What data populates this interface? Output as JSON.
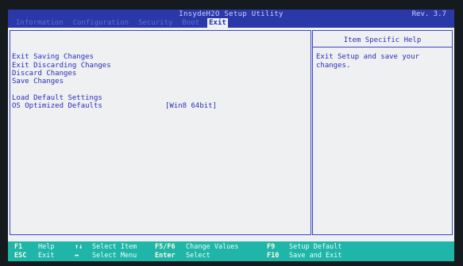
{
  "header": {
    "title": "InsydeH2O Setup Utility",
    "revision": "Rev. 3.7"
  },
  "tabs": [
    {
      "label": "Information"
    },
    {
      "label": "Configuration"
    },
    {
      "label": "Security"
    },
    {
      "label": "Boot"
    },
    {
      "label": "Exit",
      "active": true
    }
  ],
  "menu": {
    "items": [
      {
        "label": "Exit Saving Changes"
      },
      {
        "label": "Exit Discarding Changes"
      },
      {
        "label": "Discard Changes"
      },
      {
        "label": "Save Changes"
      },
      {
        "label": "Load Default Settings"
      },
      {
        "label": "OS Optimized Defaults",
        "value": "[Win8 64bit]"
      }
    ]
  },
  "help": {
    "title": "Item Specific Help",
    "text": "Exit Setup and save your changes."
  },
  "footer": {
    "row1": [
      {
        "key": "F1",
        "desc": "Help"
      },
      {
        "key": "↑↓",
        "desc": "Select Item"
      },
      {
        "key": "F5/F6",
        "desc": "Change Values"
      },
      {
        "key": "F9",
        "desc": "Setup Default"
      }
    ],
    "row2": [
      {
        "key": "ESC",
        "desc": "Exit"
      },
      {
        "key": "↔",
        "desc": "Select Menu"
      },
      {
        "key": "Enter",
        "desc": "Select"
      },
      {
        "key": "F10",
        "desc": "Save and Exit"
      }
    ]
  },
  "colors": {
    "title_bar": "#2b38a8",
    "panel_bg": "#eef0f1",
    "text": "#2b2fb8",
    "footer_bg": "#1fb5a8",
    "footer_key": "#fffbe0"
  }
}
